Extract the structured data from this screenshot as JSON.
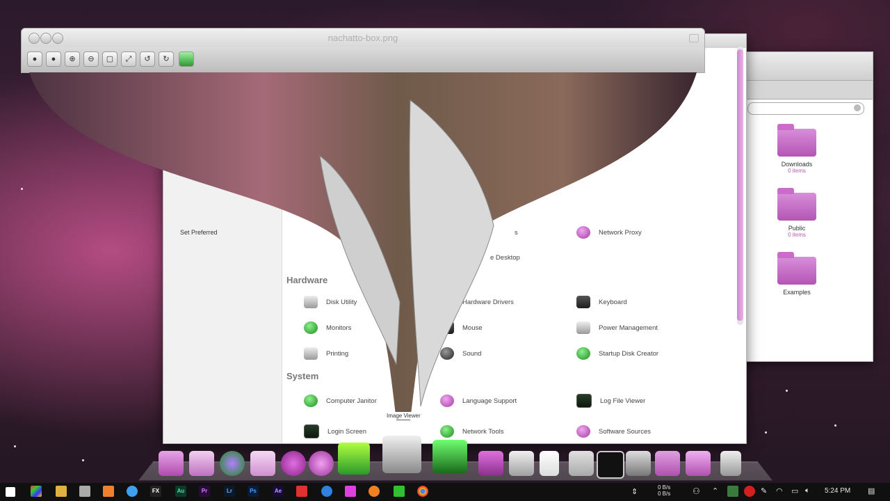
{
  "image_viewer": {
    "title": "nachatto-box.png",
    "toolbar_icons": [
      "prev-icon",
      "next-icon",
      "zoom-in-icon",
      "zoom-out-icon",
      "zoom-fit-icon",
      "fullscreen-icon",
      "rotate-left-icon",
      "rotate-right-icon",
      "edit-icon"
    ]
  },
  "system_settings": {
    "sidebar": {
      "item": "Set Preferred"
    },
    "top_fragments": {
      "row1_col2_tail": "s",
      "row2_col2_tail": "e Desktop",
      "network_proxy": "Network Proxy"
    },
    "sections": [
      {
        "title": "Hardware",
        "items": [
          {
            "label": "Disk Utility",
            "icon": "disk-utility-icon"
          },
          {
            "label": "Hardware Drivers",
            "icon": "hardware-drivers-icon"
          },
          {
            "label": "Keyboard",
            "icon": "keyboard-icon"
          },
          {
            "label": "Monitors",
            "icon": "monitors-icon"
          },
          {
            "label": "Mouse",
            "icon": "mouse-icon"
          },
          {
            "label": "Power Management",
            "icon": "power-management-icon"
          },
          {
            "label": "Printing",
            "icon": "printer-icon"
          },
          {
            "label": "Sound",
            "icon": "sound-icon"
          },
          {
            "label": "Startup Disk Creator",
            "icon": "startup-disk-icon"
          }
        ]
      },
      {
        "title": "System",
        "items": [
          {
            "label": "Computer Janitor",
            "icon": "computer-janitor-icon"
          },
          {
            "label": "Language Support",
            "icon": "language-support-icon"
          },
          {
            "label": "Log File Viewer",
            "icon": "log-viewer-icon"
          },
          {
            "label": "Login Screen",
            "icon": "login-screen-icon"
          },
          {
            "label": "Network Tools",
            "icon": "network-tools-icon"
          },
          {
            "label": "Software Sources",
            "icon": "software-sources-icon"
          }
        ]
      }
    ]
  },
  "file_manager": {
    "folders": [
      {
        "name": "Downloads",
        "sub": "0 items"
      },
      {
        "name": "Public",
        "sub": "0 items"
      },
      {
        "name": "Examples",
        "sub": ""
      }
    ]
  },
  "dock": {
    "tooltip": "Image Viewer",
    "items": [
      "downloads-icon",
      "finder-icon",
      "firefox-icon",
      "pencil-icon",
      "hearts-icon",
      "itunes-icon",
      "green-screen-icon",
      "image-viewer-icon",
      "photos-icon",
      "gallery-icon",
      "camera-icon",
      "drive-icon",
      "document-icon",
      "calculator-icon",
      "terminal-icon",
      "monitor-icon",
      "folder-icon",
      "pictures-icon",
      "trash-icon"
    ]
  },
  "taskbar": {
    "apps": [
      {
        "name": "windows-start-icon",
        "label": ""
      },
      {
        "name": "file-explorer-icon",
        "label": ""
      },
      {
        "name": "store-icon",
        "label": ""
      },
      {
        "name": "computer-icon",
        "label": ""
      },
      {
        "name": "paint-icon",
        "label": ""
      },
      {
        "name": "maps-icon",
        "label": ""
      },
      {
        "name": "fx-icon",
        "label": "FX"
      },
      {
        "name": "audition-icon",
        "label": "Au"
      },
      {
        "name": "premiere-icon",
        "label": "Pr"
      },
      {
        "name": "lightroom-icon",
        "label": "Lr"
      },
      {
        "name": "photoshop-icon",
        "label": "Ps"
      },
      {
        "name": "after-effects-icon",
        "label": "Ae"
      },
      {
        "name": "red-app-icon",
        "label": ""
      },
      {
        "name": "globe-icon",
        "label": ""
      },
      {
        "name": "pink-app-icon",
        "label": ""
      },
      {
        "name": "nodes-icon",
        "label": ""
      },
      {
        "name": "camtasia-icon",
        "label": ""
      },
      {
        "name": "chrome-icon",
        "label": ""
      }
    ],
    "net_speed_up": "0 B/s",
    "net_speed_down": "0 B/s",
    "time": "5:24 PM"
  },
  "colors": {
    "accent": "#c45cc4",
    "taskbar": "#101010"
  }
}
